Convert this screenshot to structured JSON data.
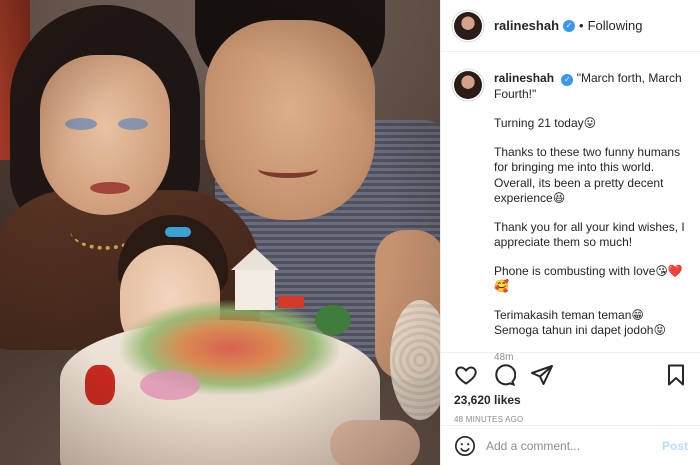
{
  "post": {
    "username": "ralineshah",
    "verified_icon": "verified-badge-icon",
    "separator": "•",
    "follow_state": "Following",
    "photo_alt": "Birthday photo"
  },
  "caption": {
    "username": "ralineshah",
    "paragraphs": [
      "\"March forth, March Fourth!\"",
      "Turning 21 today😛",
      "Thanks to these two funny humans for bringing me into this world. Overall, its been a pretty decent experience😆",
      "Thank you for all your kind wishes, I appreciate them so much!",
      "Phone is combusting with love😘❤️🥰",
      "Terimakasih teman teman😁 Semoga tahun ini dapet jodoh😝"
    ],
    "time": "48m"
  },
  "actions": {
    "like_icon": "heart-icon",
    "comment_icon": "comment-icon",
    "share_icon": "share-icon",
    "save_icon": "bookmark-icon",
    "likes": "23,620 likes",
    "posted_ago": "48 MINUTES AGO"
  },
  "comment_box": {
    "emoji_icon": "emoji-icon",
    "placeholder": "Add a comment...",
    "post_label": "Post"
  },
  "colors": {
    "accent": "#3897f0",
    "post_disabled": "#b2dffc",
    "muted": "#8e8e8e",
    "border": "#efefef"
  }
}
